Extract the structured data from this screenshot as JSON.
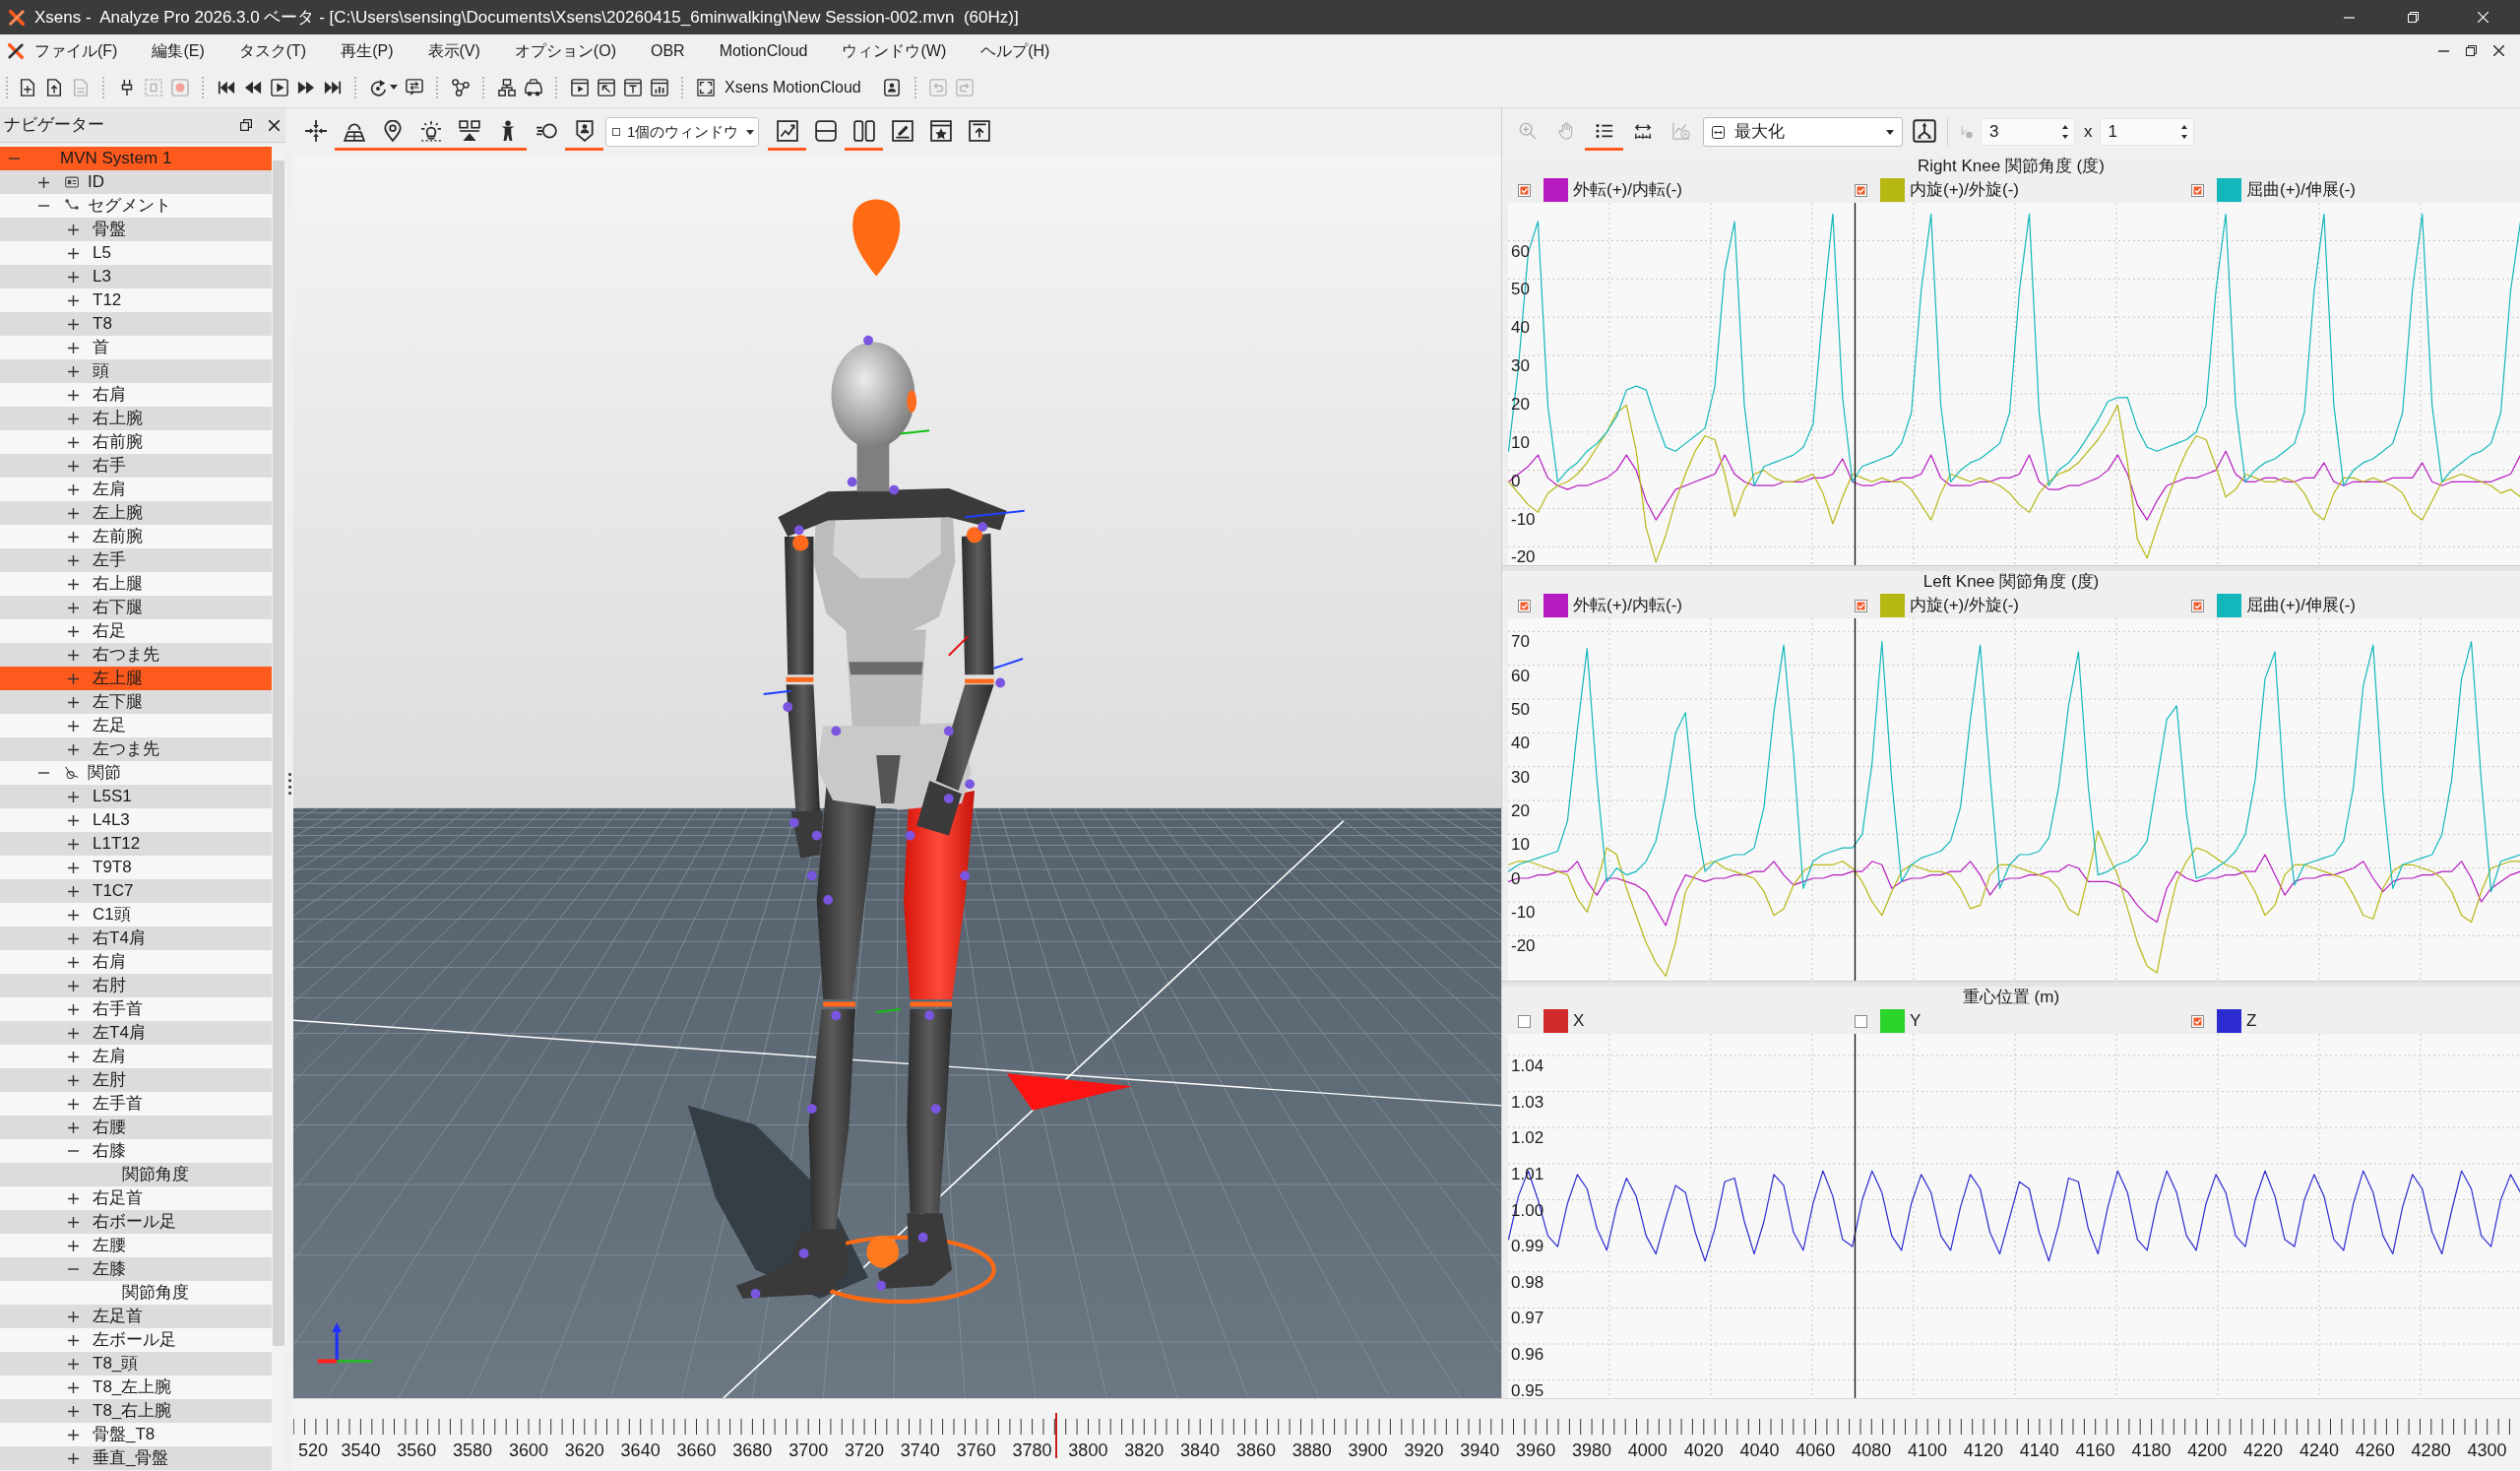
{
  "window": {
    "title": "Xsens -  Analyze Pro 2026.3.0 ベータ - [C:\\Users\\sensing\\Documents\\Xsens\\20260415_6minwalking\\New Session-002.mvn  (60Hz)]"
  },
  "menu": [
    {
      "label": "ファイル(F)"
    },
    {
      "label": "編集(E)"
    },
    {
      "label": "タスク(T)"
    },
    {
      "label": "再生(P)"
    },
    {
      "label": "表示(V)"
    },
    {
      "label": "オプション(O)"
    },
    {
      "label": "OBR"
    },
    {
      "label": "MotionCloud"
    },
    {
      "label": "ウィンドウ(W)"
    },
    {
      "label": "ヘルプ(H)"
    }
  ],
  "main_toolbar": {
    "groups": [
      [
        {
          "kind": "new-file",
          "disabled": false
        },
        {
          "kind": "open-file",
          "disabled": false
        },
        {
          "kind": "save",
          "disabled": true
        }
      ],
      [
        {
          "kind": "marker",
          "disabled": false
        },
        {
          "kind": "frame",
          "disabled": true
        },
        {
          "kind": "record",
          "disabled": true
        }
      ],
      [
        {
          "kind": "skip-start",
          "disabled": false
        },
        {
          "kind": "rewind",
          "disabled": false
        },
        {
          "kind": "play",
          "disabled": false
        },
        {
          "kind": "fast-forward",
          "disabled": false
        },
        {
          "kind": "skip-end",
          "disabled": false
        }
      ],
      [
        {
          "kind": "loop",
          "disabled": false
        },
        {
          "kind": "sync",
          "disabled": false
        }
      ],
      [
        {
          "kind": "nodes",
          "disabled": false
        }
      ],
      [
        {
          "kind": "hierarchy",
          "disabled": false
        },
        {
          "kind": "car",
          "disabled": false
        }
      ],
      [
        {
          "kind": "window-play",
          "disabled": false
        },
        {
          "kind": "window-arrow",
          "disabled": false
        },
        {
          "kind": "window-text",
          "disabled": false
        },
        {
          "kind": "window-chart",
          "disabled": false
        }
      ],
      [
        {
          "kind": "fullscreen",
          "disabled": false
        },
        {
          "kind": "label",
          "label": "Xsens MotionCloud",
          "disabled": false
        },
        {
          "kind": "badge",
          "disabled": false
        }
      ],
      [
        {
          "kind": "undo",
          "disabled": true
        },
        {
          "kind": "redo",
          "disabled": true
        }
      ]
    ]
  },
  "navigator": {
    "title": "ナビゲーター",
    "tree": [
      {
        "label": "MVN System 1",
        "expanded": true,
        "selected": true,
        "children": [
          {
            "label": "ID",
            "kind": "id",
            "expanded": false,
            "selected": false
          },
          {
            "label": "セグメント",
            "kind": "segments",
            "expanded": true,
            "selected": false,
            "children": [
              {
                "label": "骨盤",
                "expanded": false,
                "selected": false
              },
              {
                "label": "L5",
                "expanded": false,
                "selected": false
              },
              {
                "label": "L3",
                "expanded": false,
                "selected": false
              },
              {
                "label": "T12",
                "expanded": false,
                "selected": false
              },
              {
                "label": "T8",
                "expanded": false,
                "selected": false
              },
              {
                "label": "首",
                "expanded": false,
                "selected": false
              },
              {
                "label": "頭",
                "expanded": false,
                "selected": false
              },
              {
                "label": "右肩",
                "expanded": false,
                "selected": false
              },
              {
                "label": "右上腕",
                "expanded": false,
                "selected": false
              },
              {
                "label": "右前腕",
                "expanded": false,
                "selected": false
              },
              {
                "label": "右手",
                "expanded": false,
                "selected": false
              },
              {
                "label": "左肩",
                "expanded": false,
                "selected": false
              },
              {
                "label": "左上腕",
                "expanded": false,
                "selected": false
              },
              {
                "label": "左前腕",
                "expanded": false,
                "selected": false
              },
              {
                "label": "左手",
                "expanded": false,
                "selected": false
              },
              {
                "label": "右上腿",
                "expanded": false,
                "selected": false
              },
              {
                "label": "右下腿",
                "expanded": false,
                "selected": false
              },
              {
                "label": "右足",
                "expanded": false,
                "selected": false
              },
              {
                "label": "右つま先",
                "expanded": false,
                "selected": false
              },
              {
                "label": "左上腿",
                "expanded": false,
                "selected": true
              },
              {
                "label": "左下腿",
                "expanded": false,
                "selected": false
              },
              {
                "label": "左足",
                "expanded": false,
                "selected": false
              },
              {
                "label": "左つま先",
                "expanded": false,
                "selected": false
              }
            ]
          },
          {
            "label": "関節",
            "kind": "joints",
            "expanded": true,
            "selected": false,
            "children": [
              {
                "label": "L5S1",
                "expanded": false,
                "selected": false
              },
              {
                "label": "L4L3",
                "expanded": false,
                "selected": false
              },
              {
                "label": "L1T12",
                "expanded": false,
                "selected": false
              },
              {
                "label": "T9T8",
                "expanded": false,
                "selected": false
              },
              {
                "label": "T1C7",
                "expanded": false,
                "selected": false
              },
              {
                "label": "C1頭",
                "expanded": false,
                "selected": false
              },
              {
                "label": "右T4肩",
                "expanded": false,
                "selected": false
              },
              {
                "label": "右肩",
                "expanded": false,
                "selected": false
              },
              {
                "label": "右肘",
                "expanded": false,
                "selected": false
              },
              {
                "label": "右手首",
                "expanded": false,
                "selected": false
              },
              {
                "label": "左T4肩",
                "expanded": false,
                "selected": false
              },
              {
                "label": "左肩",
                "expanded": false,
                "selected": false
              },
              {
                "label": "左肘",
                "expanded": false,
                "selected": false
              },
              {
                "label": "左手首",
                "expanded": false,
                "selected": false
              },
              {
                "label": "右腰",
                "expanded": false,
                "selected": false
              },
              {
                "label": "右膝",
                "expanded": true,
                "selected": false,
                "children": [
                  {
                    "label": "関節角度",
                    "selected": false
                  }
                ]
              },
              {
                "label": "右足首",
                "expanded": false,
                "selected": false
              },
              {
                "label": "右ボール足",
                "expanded": false,
                "selected": false
              },
              {
                "label": "左腰",
                "expanded": false,
                "selected": false
              },
              {
                "label": "左膝",
                "expanded": true,
                "selected": false,
                "children": [
                  {
                    "label": "関節角度",
                    "selected": false
                  }
                ]
              },
              {
                "label": "左足首",
                "expanded": false,
                "selected": false
              },
              {
                "label": "左ボール足",
                "expanded": false,
                "selected": false
              },
              {
                "label": "T8_頭",
                "expanded": false,
                "selected": false
              },
              {
                "label": "T8_左上腕",
                "expanded": false,
                "selected": false
              },
              {
                "label": "T8_右上腕",
                "expanded": false,
                "selected": false
              },
              {
                "label": "骨盤_T8",
                "expanded": false,
                "selected": false
              },
              {
                "label": "垂直_骨盤",
                "expanded": false,
                "selected": false
              }
            ]
          }
        ]
      }
    ]
  },
  "viewport": {
    "toolbar": [
      {
        "kind": "move",
        "active": false
      },
      {
        "kind": "plane",
        "active": true
      },
      {
        "kind": "pin",
        "active": true
      },
      {
        "kind": "bulb",
        "active": true
      },
      {
        "kind": "podium",
        "active": true
      },
      {
        "kind": "person",
        "active": true
      },
      {
        "kind": "speed",
        "active": false
      },
      {
        "kind": "shield",
        "active": true
      },
      {
        "kind": "dropdown",
        "value": "1個のウィンドウ",
        "active": false
      },
      {
        "kind": "chart-window",
        "active": true
      },
      {
        "kind": "split-h",
        "active": false
      },
      {
        "kind": "split-v",
        "active": true
      },
      {
        "kind": "edit-window",
        "active": false
      },
      {
        "kind": "star-window",
        "active": false
      },
      {
        "kind": "export",
        "active": false
      }
    ]
  },
  "chart_toolbar": {
    "items": [
      {
        "kind": "zoom-in",
        "disabled": true,
        "active": false
      },
      {
        "kind": "hand",
        "disabled": true,
        "active": false
      },
      {
        "kind": "list",
        "disabled": false,
        "active": true
      },
      {
        "kind": "fit-width",
        "disabled": false,
        "active": false
      },
      {
        "kind": "chart-pause",
        "disabled": true,
        "active": false
      },
      {
        "kind": "dropdown",
        "value": "最大化",
        "disabled": false,
        "active": false
      },
      {
        "kind": "axes",
        "disabled": false,
        "active": false
      },
      {
        "kind": "scale",
        "disabled": true,
        "active": false
      },
      {
        "kind": "spinbox",
        "value": "3",
        "disabled": false,
        "active": false
      },
      {
        "kind": "text",
        "label": "x",
        "disabled": false,
        "active": false
      },
      {
        "kind": "spinbox",
        "value": "1",
        "disabled": false,
        "active": false
      }
    ]
  },
  "charts": [
    {
      "legend": [
        {
          "checked": true
        },
        {
          "checked": true
        },
        {
          "checked": true
        }
      ],
      "chart_data": {
        "type": "line",
        "title": "Right Knee 関節角度 (度)",
        "grid": true,
        "ylim": [
          -24.8,
          69.9
        ],
        "yticks": [
          60,
          50,
          40,
          30,
          20,
          10,
          0,
          -10,
          -20
        ],
        "series": [
          {
            "name": "外転(+)/内転(-)",
            "color": "#b61bbf",
            "values": [
              -3,
              -1,
              1,
              4,
              -2,
              -4,
              -5,
              -4,
              -4,
              -3,
              -2,
              0,
              4,
              0,
              -8,
              -13,
              -9,
              -5,
              -4,
              -3,
              -2,
              -1,
              4,
              -1,
              -3,
              -4,
              -4,
              -4,
              -3,
              -3,
              -3,
              -2,
              -2,
              -1,
              3,
              -3,
              -4,
              -4,
              -3,
              -3,
              -2,
              -2,
              -1,
              4,
              -2,
              -4,
              -4,
              -4,
              -3,
              -3,
              -2,
              -2,
              -1,
              4,
              -3,
              -5,
              -5,
              -4,
              -4,
              -3,
              -2,
              0,
              4,
              -1,
              -9,
              -13,
              -8,
              -4,
              -3,
              -2,
              -2,
              -1,
              0,
              5,
              -1,
              -3,
              -3,
              -2,
              -2,
              -3,
              -3,
              -2,
              -2,
              2,
              -3,
              -4,
              -3,
              -3,
              -3,
              -3,
              -2,
              -2,
              -2,
              2,
              -3,
              -4,
              -3,
              -3,
              -3,
              -3,
              -3,
              -2,
              -1,
              4
            ]
          },
          {
            "name": "内旋(+)/外旋(-)",
            "color": "#b7b712",
            "values": [
              -3,
              -6,
              -9,
              -11,
              -6,
              -4,
              -3,
              -1,
              2,
              6,
              10,
              15,
              17,
              5,
              -15,
              -24,
              -17,
              -8,
              -1,
              5,
              9,
              8,
              -1,
              -12,
              -5,
              -1,
              0,
              -2,
              -3,
              -3,
              -2,
              -1,
              -6,
              -14,
              -7,
              -1,
              -2,
              -3,
              -2,
              -3,
              -3,
              -5,
              -9,
              -13,
              -6,
              -1,
              -2,
              -3,
              -2,
              -3,
              -4,
              -6,
              -9,
              -11,
              -6,
              -3,
              -1,
              0,
              2,
              5,
              8,
              12,
              17,
              2,
              -18,
              -23,
              -15,
              -8,
              -1,
              5,
              9,
              8,
              1,
              -7,
              -5,
              -1,
              -2,
              -3,
              -3,
              -2,
              -3,
              -6,
              -11,
              -13,
              -6,
              -2,
              -2,
              -3,
              -2,
              -3,
              -4,
              -6,
              -11,
              -13,
              -8,
              -3,
              -2,
              -1,
              -2,
              -3,
              -4,
              -6,
              -5,
              -7
            ]
          },
          {
            "name": "屈曲(+)/伸展(-)",
            "color": "#12b7bb",
            "values": [
              5,
              27,
              57,
              65,
              17,
              -3,
              0,
              2,
              5,
              7,
              10,
              14,
              21,
              22,
              21,
              13,
              6,
              5,
              7,
              9,
              11,
              22,
              52,
              65,
              17,
              -4,
              1,
              2,
              3,
              4,
              6,
              12,
              42,
              67,
              19,
              -3,
              1,
              2,
              3,
              4,
              7,
              15,
              47,
              67,
              17,
              -3,
              0,
              2,
              3,
              5,
              7,
              15,
              47,
              67,
              15,
              -4,
              0,
              2,
              5,
              9,
              13,
              18,
              19,
              19,
              11,
              6,
              5,
              6,
              7,
              8,
              10,
              17,
              47,
              67,
              17,
              -3,
              0,
              2,
              3,
              5,
              7,
              15,
              47,
              67,
              17,
              -4,
              0,
              2,
              3,
              5,
              7,
              15,
              47,
              67,
              17,
              -3,
              0,
              2,
              4,
              5,
              7,
              15,
              47,
              65
            ]
          }
        ]
      }
    },
    {
      "legend": [
        {
          "checked": true
        },
        {
          "checked": true
        },
        {
          "checked": true
        }
      ],
      "chart_data": {
        "type": "line",
        "title": "Left Knee 関節角度 (度)",
        "grid": true,
        "ylim": [
          -33.3,
          73.9
        ],
        "yticks": [
          70,
          60,
          50,
          40,
          30,
          20,
          10,
          0,
          -10,
          -20
        ],
        "series": [
          {
            "name": "外転(+)/内転(-)",
            "color": "#b61bbf",
            "values": [
              -4,
              -3,
              -3,
              -2,
              -2,
              -1,
              -1,
              2,
              -4,
              -8,
              -3,
              -3,
              -4,
              -5,
              -7,
              -12,
              -17,
              -8,
              -2,
              -3,
              -4,
              -3,
              -3,
              -2,
              -2,
              -1,
              -1,
              2,
              -2,
              -5,
              -4,
              -3,
              -3,
              -2,
              -2,
              -1,
              -1,
              2,
              1,
              -6,
              -4,
              -3,
              -3,
              -2,
              -2,
              -1,
              -1,
              2,
              -2,
              -8,
              -4,
              -3,
              -3,
              -2,
              -2,
              -1,
              -1,
              1,
              0,
              -4,
              -4,
              -4,
              -5,
              -7,
              -11,
              -14,
              -16,
              -6,
              -1,
              -3,
              -4,
              -3,
              -3,
              -2,
              -2,
              -1,
              -1,
              4,
              -2,
              -8,
              -4,
              -3,
              -3,
              -2,
              -2,
              -1,
              0,
              2,
              -3,
              -7,
              -4,
              -3,
              -3,
              -2,
              -2,
              -1,
              -1,
              2,
              -3,
              -10,
              -6,
              -4,
              -2,
              -1
            ]
          },
          {
            "name": "内旋(+)/外旋(-)",
            "color": "#b7b712",
            "values": [
              1,
              2,
              2,
              1,
              0,
              -1,
              -2,
              -9,
              -13,
              -4,
              6,
              4,
              -6,
              -14,
              -22,
              -28,
              -32,
              -22,
              -7,
              -2,
              1,
              2,
              0,
              -1,
              -2,
              -3,
              -7,
              -14,
              -12,
              -5,
              -1,
              1,
              1,
              1,
              2,
              0,
              -4,
              -10,
              -14,
              -7,
              -1,
              1,
              0,
              -1,
              -1,
              -2,
              -6,
              -12,
              -11,
              -2,
              1,
              1,
              0,
              -1,
              -2,
              -3,
              -6,
              -12,
              -14,
              -2,
              11,
              4,
              -2,
              -12,
              -22,
              -29,
              -31,
              -16,
              -4,
              2,
              6,
              5,
              3,
              1,
              0,
              -2,
              -7,
              -14,
              -11,
              -2,
              1,
              1,
              0,
              -1,
              -2,
              -3,
              -8,
              -14,
              -15,
              -6,
              -1,
              1,
              1,
              0,
              -1,
              -3,
              -7,
              -14,
              -16,
              -7,
              0,
              1,
              2,
              2
            ]
          },
          {
            "name": "屈曲(+)/伸展(-)",
            "color": "#12b7bb",
            "values": [
              -1,
              1,
              2,
              3,
              4,
              5,
              14,
              41,
              65,
              26,
              -4,
              0,
              -2,
              -1,
              2,
              8,
              22,
              40,
              46,
              16,
              -1,
              2,
              3,
              4,
              4,
              6,
              18,
              46,
              66,
              34,
              -6,
              2,
              4,
              5,
              6,
              6,
              10,
              31,
              67,
              26,
              -4,
              1,
              3,
              4,
              5,
              8,
              18,
              44,
              66,
              28,
              -6,
              1,
              4,
              4,
              5,
              9,
              24,
              48,
              64,
              24,
              -2,
              -1,
              1,
              2,
              4,
              8,
              26,
              44,
              48,
              16,
              -3,
              -2,
              0,
              2,
              5,
              10,
              26,
              56,
              64,
              20,
              -5,
              1,
              2,
              3,
              4,
              8,
              24,
              54,
              66,
              22,
              -6,
              1,
              2,
              3,
              4,
              10,
              26,
              56,
              67,
              26,
              -7,
              2,
              3,
              4
            ]
          }
        ]
      }
    },
    {
      "legend": [
        {
          "checked": false
        },
        {
          "checked": false
        },
        {
          "checked": true
        }
      ],
      "chart_data": {
        "type": "line",
        "title": "重心位置 (m)",
        "grid": true,
        "ylim": [
          0.945,
          1.046
        ],
        "yticks": [
          {
            "value": 1.04,
            "label": "1.04"
          },
          {
            "value": 1.03,
            "label": "1.03"
          },
          {
            "value": 1.02,
            "label": "1.02"
          },
          {
            "value": 1.01,
            "label": "1.01"
          },
          {
            "value": 1,
            "label": "1.00"
          },
          {
            "value": 0.99,
            "label": "0.99"
          },
          {
            "value": 0.98,
            "label": "0.98"
          },
          {
            "value": 0.97,
            "label": "0.97"
          },
          {
            "value": 0.96,
            "label": "0.96"
          },
          {
            "value": 0.95,
            "label": "0.95"
          }
        ],
        "series": [
          {
            "name": "X",
            "color": "#d22a2a"
          },
          {
            "name": "Y",
            "color": "#2bd42b"
          },
          {
            "name": "Z",
            "color": "#2b2bd0",
            "values": [
              0.989,
              1.001,
              1.008,
              1.0,
              0.99,
              0.987,
              0.999,
              1.007,
              1.003,
              0.992,
              0.986,
              0.998,
              1.006,
              1.001,
              0.99,
              0.985,
              0.995,
              1.004,
              1.002,
              0.991,
              0.983,
              0.992,
              1.005,
              1.006,
              0.994,
              0.985,
              0.994,
              1.007,
              1.004,
              0.991,
              0.986,
              0.999,
              1.008,
              1.001,
              0.989,
              0.987,
              1.0,
              1.008,
              1.002,
              0.99,
              0.986,
              0.999,
              1.007,
              1.002,
              0.99,
              0.986,
              0.998,
              1.007,
              1.003,
              0.991,
              0.985,
              0.995,
              1.005,
              1.003,
              0.991,
              0.983,
              0.993,
              1.006,
              1.005,
              0.992,
              0.985,
              0.998,
              1.008,
              1.002,
              0.989,
              0.986,
              0.999,
              1.008,
              1.002,
              0.99,
              0.986,
              0.999,
              1.007,
              1.002,
              0.99,
              0.987,
              1.0,
              1.008,
              1.001,
              0.989,
              0.987,
              1.0,
              1.007,
              1.001,
              0.989,
              0.986,
              0.999,
              1.008,
              1.002,
              0.99,
              0.985,
              0.998,
              1.007,
              1.003,
              0.991,
              0.985,
              0.997,
              1.008,
              1.003,
              0.99,
              0.987,
              1.0,
              1.007,
              1.002
            ]
          }
        ]
      }
    }
  ],
  "timeline": {
    "labels": [
      "520",
      "3540",
      "3560",
      "3580",
      "3600",
      "3620",
      "3640",
      "3660",
      "3680",
      "3700",
      "3720",
      "3740",
      "3760",
      "3780",
      "3800",
      "3820",
      "3840",
      "3860",
      "3880",
      "3900",
      "3920",
      "3940",
      "3960",
      "3980",
      "4000",
      "4020",
      "4040",
      "4060",
      "4080",
      "4100",
      "4120",
      "4140",
      "4160",
      "4180",
      "4200",
      "4220",
      "4240",
      "4260",
      "4280",
      "4300"
    ],
    "level": 0.3426
  }
}
